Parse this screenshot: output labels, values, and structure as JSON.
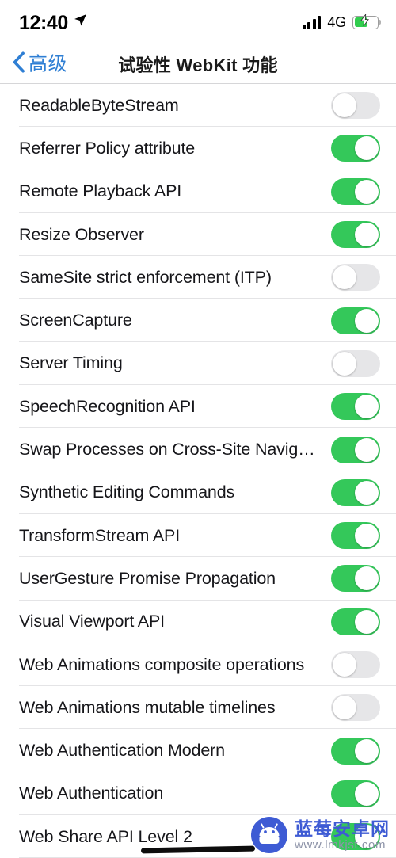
{
  "status_bar": {
    "time": "12:40",
    "location_icon": "location-arrow-icon",
    "signal_icon": "cellular-signal-icon",
    "network": "4G",
    "battery_icon": "battery-charging-icon",
    "battery_level_percent": 58
  },
  "nav": {
    "back_label": "高级",
    "back_icon": "chevron-left-icon",
    "title": "试验性 WebKit 功能"
  },
  "rows": [
    {
      "label": "ReadableByteStream",
      "enabled": false
    },
    {
      "label": "Referrer Policy attribute",
      "enabled": true
    },
    {
      "label": "Remote Playback API",
      "enabled": true
    },
    {
      "label": "Resize Observer",
      "enabled": true
    },
    {
      "label": "SameSite strict enforcement (ITP)",
      "enabled": false
    },
    {
      "label": "ScreenCapture",
      "enabled": true
    },
    {
      "label": "Server Timing",
      "enabled": false
    },
    {
      "label": "SpeechRecognition API",
      "enabled": true
    },
    {
      "label": "Swap Processes on Cross-Site Navigati…",
      "enabled": true
    },
    {
      "label": "Synthetic Editing Commands",
      "enabled": true
    },
    {
      "label": "TransformStream API",
      "enabled": true
    },
    {
      "label": "UserGesture Promise Propagation",
      "enabled": true
    },
    {
      "label": "Visual Viewport API",
      "enabled": true
    },
    {
      "label": "Web Animations composite operations",
      "enabled": false
    },
    {
      "label": "Web Animations mutable timelines",
      "enabled": false
    },
    {
      "label": "Web Authentication Modern",
      "enabled": true
    },
    {
      "label": "Web Authentication",
      "enabled": true
    },
    {
      "label": "Web Share API Level 2",
      "enabled": true
    }
  ],
  "watermark": {
    "logo_icon": "android-robot-icon",
    "site_name": "蓝莓安卓网",
    "url": "www.lmkjst.com"
  },
  "colors": {
    "switch_on": "#34c85a",
    "switch_off": "#e6e6e8",
    "accent_blue": "#2f7fd4",
    "watermark_blue": "#3e5bd4",
    "separator": "#e4e4e6"
  }
}
